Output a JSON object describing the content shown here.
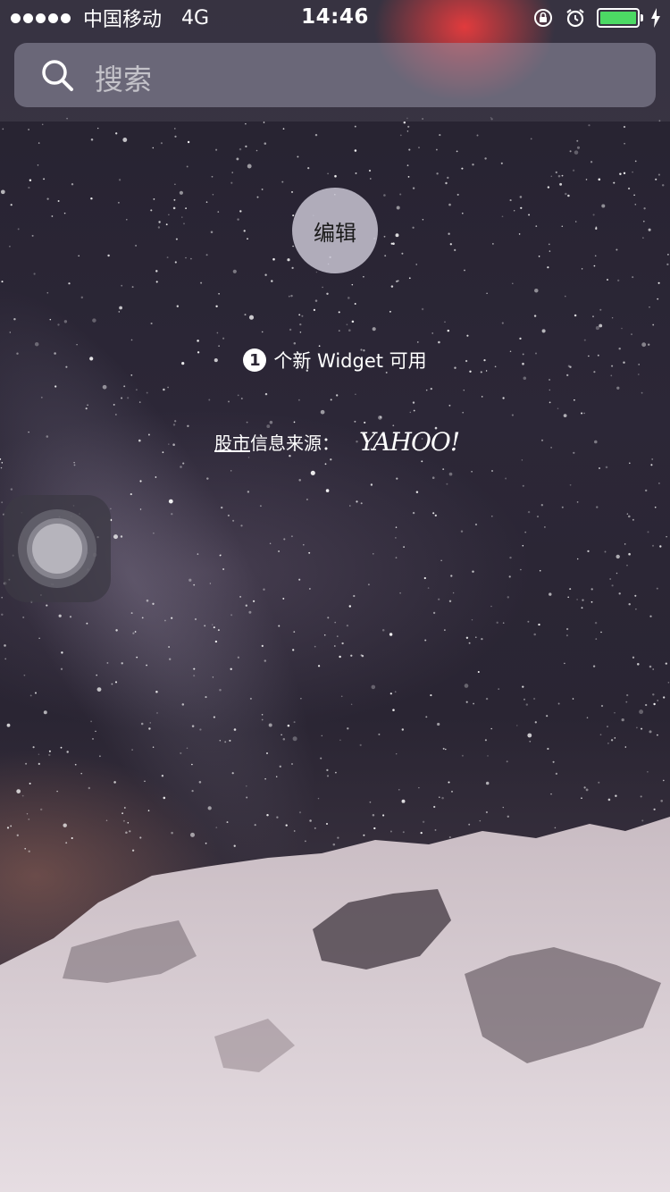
{
  "status_bar": {
    "carrier": "中国移动",
    "network": "4G",
    "time": "14:46",
    "battery_level": 1.0,
    "icons": [
      "signal-dots-icon",
      "rotation-lock-icon",
      "alarm-icon",
      "battery-icon",
      "charging-icon"
    ]
  },
  "search": {
    "placeholder": "搜索",
    "icon": "search-icon"
  },
  "edit_button": {
    "label": "编辑"
  },
  "new_widget": {
    "count": "1",
    "text": "个新 Widget 可用"
  },
  "stocks_source": {
    "link_label": "股市",
    "suffix": "信息来源：",
    "brand": "YAHOO!"
  },
  "assistive_touch": {
    "icon": "assistive-touch-icon"
  },
  "colors": {
    "battery_fill": "#4cd964",
    "sky": "#2a2533"
  }
}
